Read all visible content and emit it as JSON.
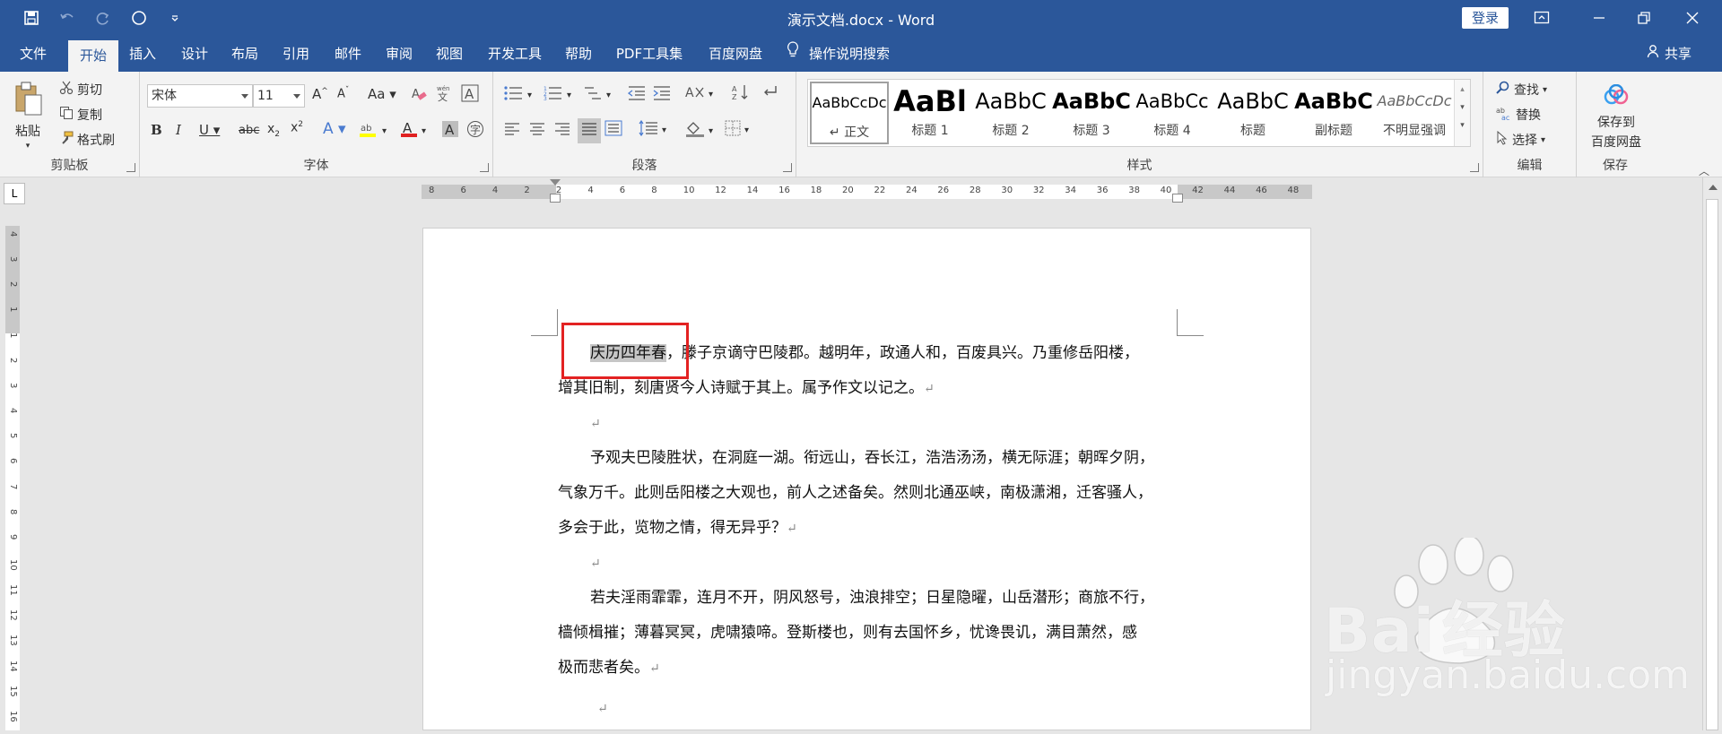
{
  "titlebar": {
    "title": "演示文档.docx  -  Word",
    "login": "登录"
  },
  "menu": {
    "tabs": [
      "文件",
      "开始",
      "插入",
      "设计",
      "布局",
      "引用",
      "邮件",
      "审阅",
      "视图",
      "开发工具",
      "帮助",
      "PDF工具集",
      "百度网盘"
    ],
    "active": "开始",
    "tell_me": "操作说明搜索",
    "share": "共享"
  },
  "ribbon": {
    "clipboard": {
      "label": "剪贴板",
      "paste": "粘贴",
      "cut": "剪切",
      "copy": "复制",
      "format_painter": "格式刷"
    },
    "font": {
      "label": "字体",
      "font_name": "宋体",
      "font_size": "11"
    },
    "paragraph": {
      "label": "段落"
    },
    "styles": {
      "label": "样式",
      "items": [
        {
          "preview": "AaBbCcDc",
          "name": "↵ 正文"
        },
        {
          "preview": "AaBl",
          "name": "标题 1"
        },
        {
          "preview": "AaBbC",
          "name": "标题 2"
        },
        {
          "preview": "AaBbC",
          "name": "标题 3"
        },
        {
          "preview": "AaBbCc",
          "name": "标题 4"
        },
        {
          "preview": "AaBbC",
          "name": "标题"
        },
        {
          "preview": "AaBbC",
          "name": "副标题"
        },
        {
          "preview": "AaBbCcDc",
          "name": "不明显强调"
        }
      ]
    },
    "editing": {
      "label": "编辑",
      "find": "查找",
      "replace": "替换",
      "select": "选择"
    },
    "save": {
      "label": "保存",
      "button_line1": "保存到",
      "button_line2": "百度网盘"
    }
  },
  "ruler": {
    "h_ticks": [
      "8",
      "6",
      "4",
      "2",
      "2",
      "4",
      "6",
      "8",
      "10",
      "12",
      "14",
      "16",
      "18",
      "20",
      "22",
      "24",
      "26",
      "28",
      "30",
      "32",
      "34",
      "36",
      "38",
      "40",
      "42",
      "44",
      "46",
      "48"
    ],
    "v_ticks": [
      "4",
      "3",
      "2",
      "1",
      "1",
      "2",
      "3",
      "4",
      "5",
      "6",
      "7",
      "8",
      "9",
      "10",
      "11",
      "12",
      "13",
      "14",
      "15",
      "16"
    ],
    "corner": "L"
  },
  "document": {
    "para1_highlight": "庆历四年春",
    "para1_line1_rest": "，滕子京谪守巴陵郡。越明年，政通人和，百废具兴。乃重修岳阳楼，",
    "para1_line2": "增其旧制，刻唐贤今人诗赋于其上。属予作文以记之。",
    "para2_line1": "予观夫巴陵胜状，在洞庭一湖。衔远山，吞长江，浩浩汤汤，横无际涯；朝晖夕阴，",
    "para2_line2": "气象万千。此则岳阳楼之大观也，前人之述备矣。然则北通巫峡，南极潇湘，迁客骚人，",
    "para2_line3": "多会于此，览物之情，得无异乎？",
    "para3_line1": "若夫淫雨霏霏，连月不开，阴风怒号，浊浪排空；日星隐曜，山岳潜形；商旅不行，",
    "para3_line2": "樯倾楫摧；薄暮冥冥，虎啸猿啼。登斯楼也，则有去国怀乡，忧谗畏讥，满目萧然，感",
    "para3_line3": "极而悲者矣。",
    "para_mark": "↵"
  },
  "watermark": {
    "main": "Bai",
    "cn": "经验",
    "sub": "jingyan.baidu.com"
  },
  "colors": {
    "brand": "#2b579a",
    "highlight_box": "#e32222"
  }
}
